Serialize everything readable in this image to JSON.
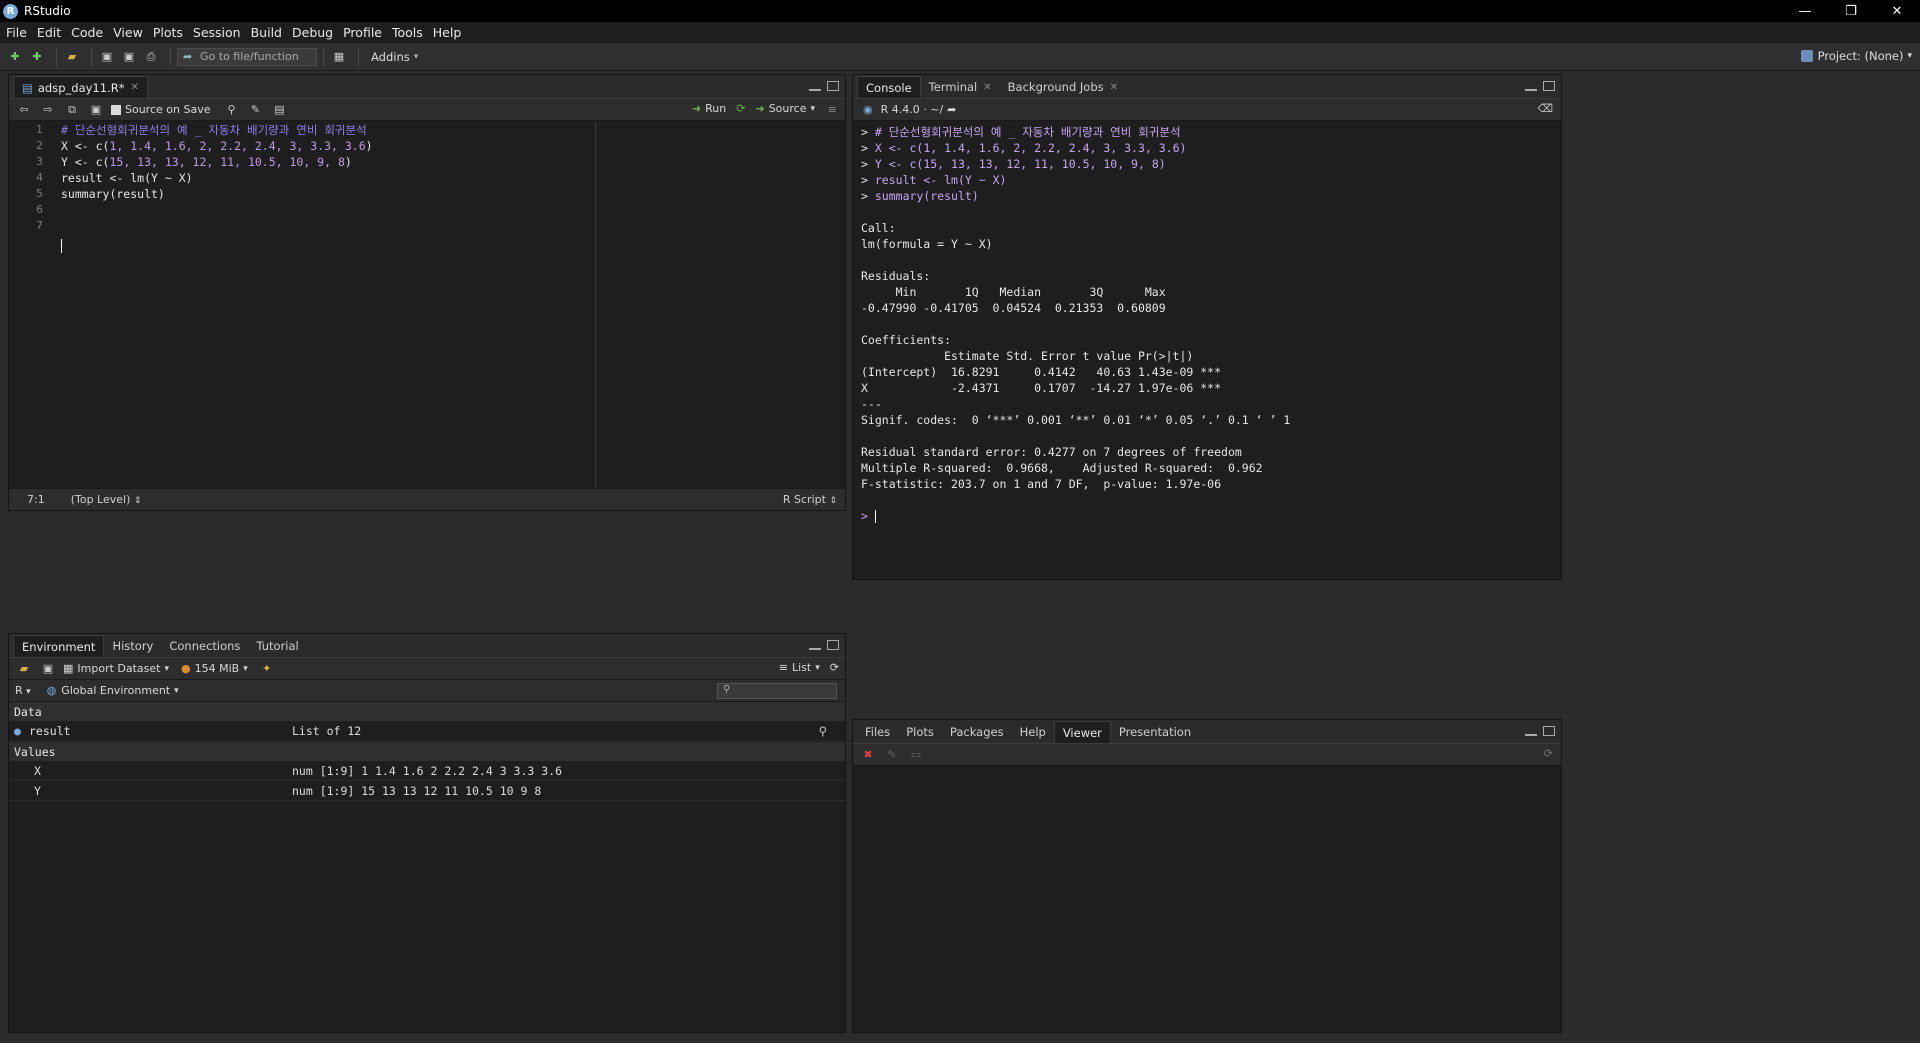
{
  "window": {
    "title": "RStudio"
  },
  "menu": [
    "File",
    "Edit",
    "Code",
    "View",
    "Plots",
    "Session",
    "Build",
    "Debug",
    "Profile",
    "Tools",
    "Help"
  ],
  "toolbar": {
    "goto_placeholder": "Go to file/function",
    "addins": "Addins",
    "project": "Project: (None)"
  },
  "source": {
    "tab": "adsp_day11.R*",
    "source_on_save": "Source on Save",
    "run": "Run",
    "source_btn": "Source",
    "line_numbers": [
      "1",
      "2",
      "3",
      "4",
      "5",
      "6",
      "7"
    ],
    "lines": {
      "l1": "# 단순선형회귀분석의 예 _ 자동차 배기량과 연비 회귀분석",
      "l2_a": "X <- c(",
      "l2_b": "1, 1.4, 1.6, 2, 2.2, 2.4, 3, 3.3, 3.6",
      "l2_c": ")",
      "l3_a": "Y <- c(",
      "l3_b": "15, 13, 13, 12, 11, 10.5, 10, 9, 8",
      "l3_c": ")",
      "l4": "result <- lm(Y ~ X)",
      "l5": "summary(result)"
    },
    "status": {
      "position": "7:1",
      "scope": "(Top Level)",
      "filetype": "R Script"
    }
  },
  "console": {
    "tabs": [
      "Console",
      "Terminal",
      "Background Jobs"
    ],
    "version": "R 4.4.0 · ~/",
    "inputs": {
      "i1": "# 단순선형회귀분석의 예 _ 자동차 배기량과 연비 회귀분석",
      "i2": "X <- c(1, 1.4, 1.6, 2, 2.2, 2.4, 3, 3.3, 3.6)",
      "i3": "Y <- c(15, 13, 13, 12, 11, 10.5, 10, 9, 8)",
      "i4": "result <- lm(Y ~ X)",
      "i5": "summary(result)"
    },
    "output": {
      "o1": "Call:",
      "o2": "lm(formula = Y ~ X)",
      "o3": "Residuals:",
      "o4": "     Min       1Q   Median       3Q      Max ",
      "o5": "-0.47990 -0.41705  0.04524  0.21353  0.60809 ",
      "o6": "Coefficients:",
      "o7": "            Estimate Std. Error t value Pr(>|t|)    ",
      "o8": "(Intercept)  16.8291     0.4142   40.63 1.43e-09 ***",
      "o9": "X            -2.4371     0.1707  -14.27 1.97e-06 ***",
      "o10": "---",
      "o11": "Signif. codes:  0 ‘***’ 0.001 ‘**’ 0.01 ‘*’ 0.05 ‘.’ 0.1 ‘ ’ 1",
      "o12": "Residual standard error: 0.4277 on 7 degrees of freedom",
      "o13": "Multiple R-squared:  0.9668,\tAdjusted R-squared:  0.962 ",
      "o14": "F-statistic: 203.7 on 1 and 7 DF,  p-value: 1.97e-06"
    },
    "prompt": ">"
  },
  "environment": {
    "tabs": [
      "Environment",
      "History",
      "Connections",
      "Tutorial"
    ],
    "import_dataset": "Import Dataset",
    "memory": "154 MiB",
    "view_mode": "List",
    "lang": "R",
    "scope": "Global Environment",
    "sections": {
      "data": "Data",
      "values": "Values"
    },
    "data_rows": [
      {
        "name": "result",
        "value": "List of  12"
      }
    ],
    "value_rows": [
      {
        "name": "X",
        "value": "num [1:9] 1 1.4 1.6 2 2.2 2.4 3 3.3 3.6"
      },
      {
        "name": "Y",
        "value": "num [1:9] 15 13 13 12 11 10.5 10 9 8"
      }
    ]
  },
  "files": {
    "tabs": [
      "Files",
      "Plots",
      "Packages",
      "Help",
      "Viewer",
      "Presentation"
    ]
  }
}
